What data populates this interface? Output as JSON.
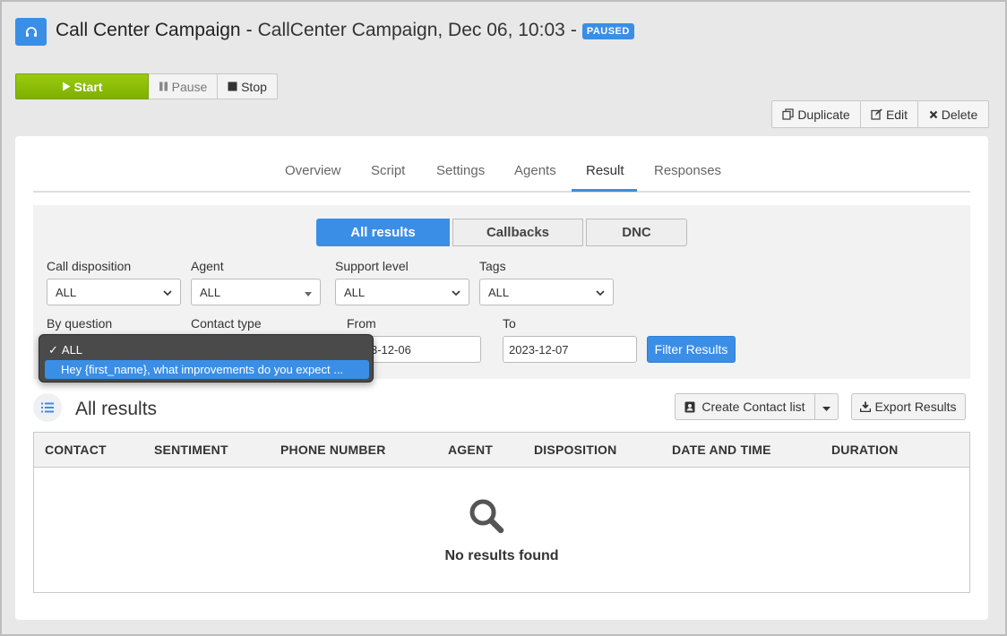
{
  "header": {
    "icon": "headset-icon",
    "title": "Call Center Campaign",
    "separator": "-",
    "subtitle": "CallCenter Campaign, Dec 06, 10:03",
    "dash": "-",
    "status": "PAUSED"
  },
  "controls": {
    "start": "Start",
    "pause": "Pause",
    "stop": "Stop"
  },
  "actions": {
    "duplicate": "Duplicate",
    "edit": "Edit",
    "delete": "Delete"
  },
  "tabs": [
    "Overview",
    "Script",
    "Settings",
    "Agents",
    "Result",
    "Responses"
  ],
  "active_tab": "Result",
  "segments": [
    "All results",
    "Callbacks",
    "DNC"
  ],
  "filters": {
    "call_disposition": {
      "label": "Call disposition",
      "value": "ALL"
    },
    "agent": {
      "label": "Agent",
      "value": "ALL"
    },
    "support_level": {
      "label": "Support level",
      "value": "ALL"
    },
    "tags": {
      "label": "Tags",
      "value": "ALL"
    },
    "by_question": {
      "label": "By question"
    },
    "contact_type": {
      "label": "Contact type"
    },
    "from": {
      "label": "From",
      "value": "2023-12-06",
      "visible_value": "3-12-06"
    },
    "to": {
      "label": "To",
      "value": "2023-12-07"
    },
    "submit": "Filter Results"
  },
  "question_dropdown": {
    "options": [
      "ALL",
      "Hey {first_name}, what improvements do you expect ..."
    ],
    "selected": "ALL",
    "check": "✓"
  },
  "results": {
    "title": "All results",
    "create_contact_list": "Create Contact list",
    "export": "Export Results",
    "columns": [
      "CONTACT",
      "SENTIMENT",
      "PHONE NUMBER",
      "AGENT",
      "DISPOSITION",
      "DATE AND TIME",
      "DURATION"
    ],
    "empty_message": "No results found"
  },
  "colors": {
    "accent": "#3a8ee6",
    "start_green": "#8dbf08",
    "background": "#e8e8e8"
  }
}
